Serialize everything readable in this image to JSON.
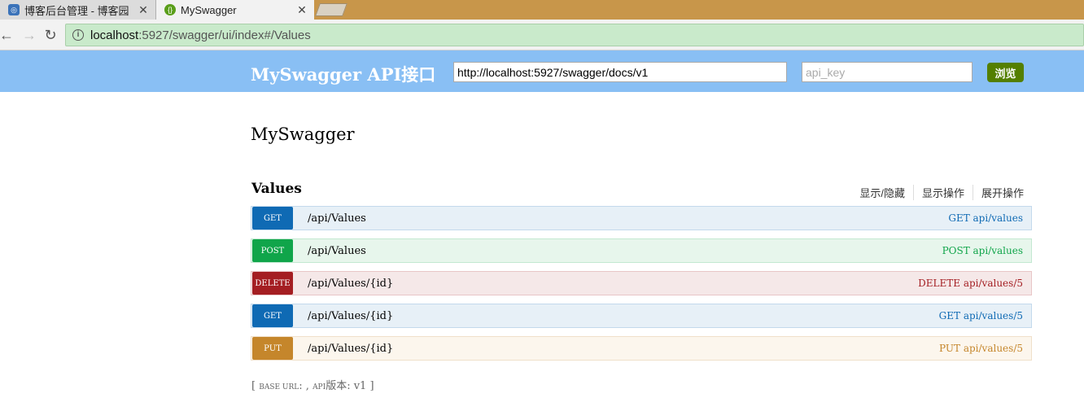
{
  "browser": {
    "tabs": [
      {
        "title": "博客后台管理 - 博客园",
        "close": "✕"
      },
      {
        "title": "MySwagger",
        "close": "✕"
      }
    ],
    "address": {
      "host": "localhost",
      "rest": ":5927/swagger/ui/index#/Values"
    }
  },
  "header": {
    "title": "MySwagger API接口",
    "url_value": "http://localhost:5927/swagger/docs/v1",
    "api_key_placeholder": "api_key",
    "explore_label": "浏览"
  },
  "api": {
    "title": "MySwagger"
  },
  "resource": {
    "name": "Values",
    "actions": [
      "显示/隐藏",
      "显示操作",
      "展开操作"
    ],
    "operations": [
      {
        "method": "GET",
        "path": "/api/Values",
        "summary": "GET api/values"
      },
      {
        "method": "POST",
        "path": "/api/Values",
        "summary": "POST api/values"
      },
      {
        "method": "DELETE",
        "path": "/api/Values/{id}",
        "summary": "DELETE api/values/5"
      },
      {
        "method": "GET",
        "path": "/api/Values/{id}",
        "summary": "GET api/values/5"
      },
      {
        "method": "PUT",
        "path": "/api/Values/{id}",
        "summary": "PUT api/values/5"
      }
    ]
  },
  "footer": {
    "open": "[ ",
    "base_label": "BASE URL",
    "base_sep": ": , ",
    "api_label": "API",
    "version_label": "版本: v1 ]"
  },
  "colors": {
    "header_bg": "#89bff4",
    "get": "#0f6ab4",
    "post": "#10a54a",
    "delete": "#a41e22",
    "put": "#c5862b",
    "explore": "#547f00"
  }
}
